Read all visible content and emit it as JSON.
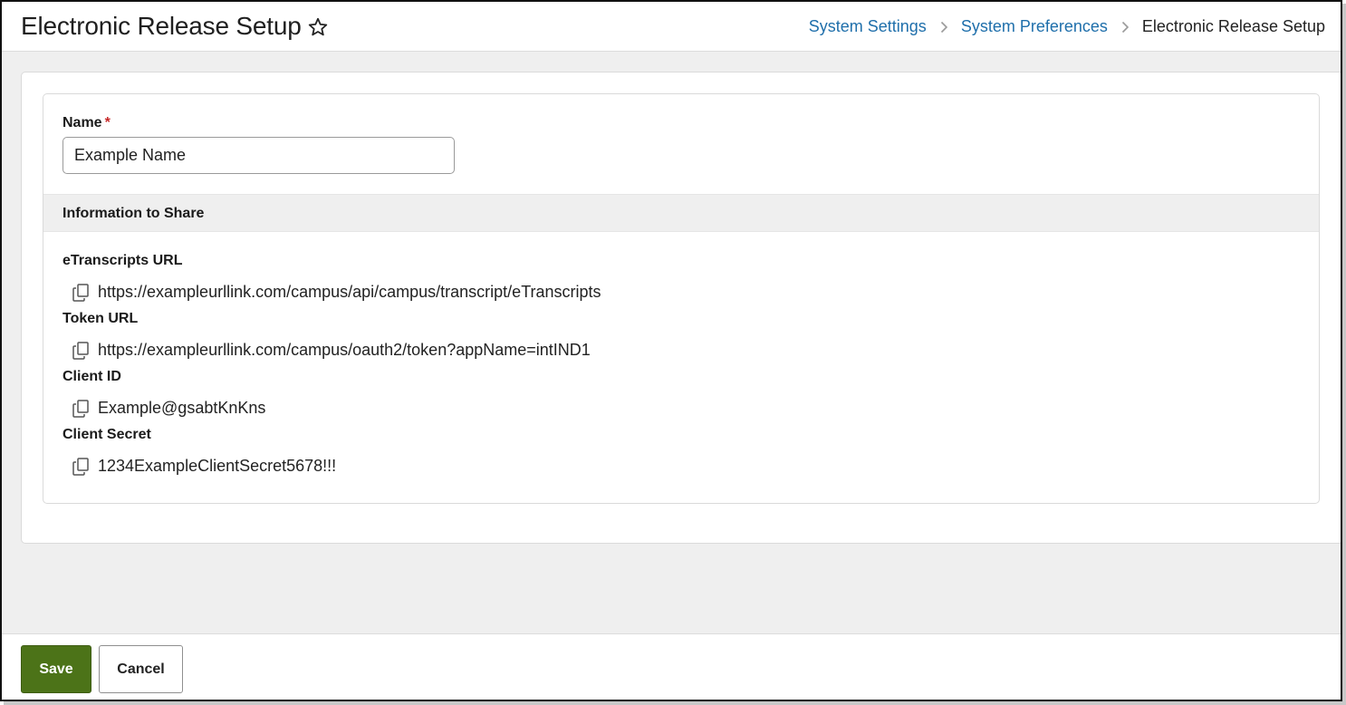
{
  "header": {
    "title": "Electronic Release Setup",
    "breadcrumb": {
      "items": [
        "System Settings",
        "System Preferences"
      ],
      "current": "Electronic Release Setup"
    }
  },
  "form": {
    "name_label": "Name",
    "required_mark": "*",
    "name_value": "Example Name",
    "section_title": "Information to Share",
    "fields": [
      {
        "label": "eTranscripts URL",
        "value": "https://exampleurllink.com/campus/api/campus/transcript/eTranscripts"
      },
      {
        "label": "Token URL",
        "value": "https://exampleurllink.com/campus/oauth2/token?appName=intIND1"
      },
      {
        "label": "Client ID",
        "value": "Example@gsabtKnKns"
      },
      {
        "label": "Client Secret",
        "value": "1234ExampleClientSecret5678!!!"
      }
    ]
  },
  "footer": {
    "save_label": "Save",
    "cancel_label": "Cancel"
  },
  "icons": {
    "favorite": "star-outline-icon",
    "separator": "chevron-right-icon",
    "copy": "copy-icon"
  },
  "colors": {
    "link": "#1f6fab",
    "save_button": "#4c7318",
    "required": "#c62828"
  }
}
